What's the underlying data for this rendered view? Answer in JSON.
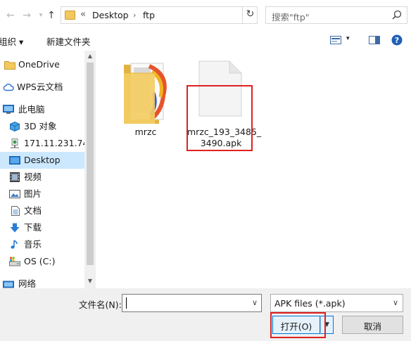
{
  "address_bar": {
    "overflow_chevron": "«",
    "path": [
      "Desktop",
      "ftp"
    ]
  },
  "search": {
    "placeholder": "搜索\"ftp\""
  },
  "toolbar": {
    "organize_label": "组织 ▾",
    "new_folder_label": "新建文件夹"
  },
  "nav": {
    "items": [
      {
        "label": "OneDrive",
        "icon": "folder-icon"
      },
      {
        "label": "WPS云文档",
        "icon": "cloud-icon"
      },
      {
        "label": "此电脑",
        "icon": "computer-icon"
      },
      {
        "label": "3D 对象",
        "icon": "cube-icon"
      },
      {
        "label": "171.11.231.74",
        "icon": "network-drive-icon"
      },
      {
        "label": "Desktop",
        "icon": "desktop-icon",
        "selected": true
      },
      {
        "label": "视频",
        "icon": "video-icon"
      },
      {
        "label": "图片",
        "icon": "picture-icon"
      },
      {
        "label": "文档",
        "icon": "document-icon"
      },
      {
        "label": "下载",
        "icon": "download-icon"
      },
      {
        "label": "音乐",
        "icon": "music-icon"
      },
      {
        "label": "OS (C:)",
        "icon": "drive-icon"
      },
      {
        "label": "网络",
        "icon": "network-icon"
      }
    ]
  },
  "files": [
    {
      "name": "mrzc",
      "type": "folder"
    },
    {
      "name_line1": "mrzc_193_3485_",
      "name_line2": "3490.apk",
      "type": "file",
      "highlighted": true
    }
  ],
  "bottom": {
    "filename_label": "文件名(N):",
    "filename_value": "",
    "filetype_value": "APK files (*.apk)",
    "open_label": "打开(O)",
    "cancel_label": "取消"
  },
  "colors": {
    "selection": "#cce8ff",
    "highlight": "#e02020",
    "accent": "#0078d7"
  }
}
